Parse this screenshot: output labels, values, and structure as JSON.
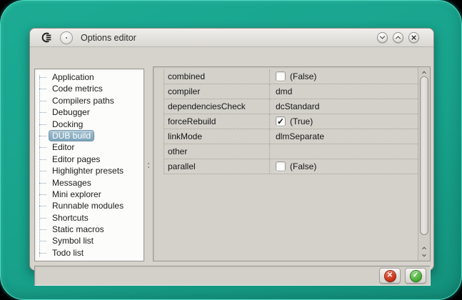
{
  "colors": {
    "teal_background": "#18a28c",
    "teal_rim": "#49e2cb",
    "window_background": "#d6d3cd",
    "selection_blue": "#87acc1",
    "cancel_red": "#c3301a",
    "ok_green": "#4aab38"
  },
  "titlebar": {
    "title": "Options editor",
    "logo_icon": "coedit-logo",
    "menu_button_icon": "window-menu-circle",
    "buttons": [
      {
        "name": "shade",
        "icon": "chevron-down-icon"
      },
      {
        "name": "maximize",
        "icon": "chevron-up-icon"
      },
      {
        "name": "close",
        "icon": "close-x-icon",
        "glyph": "×"
      }
    ]
  },
  "sidebar": {
    "items": [
      {
        "label": "Application",
        "selected": false
      },
      {
        "label": "Code metrics",
        "selected": false
      },
      {
        "label": "Compilers paths",
        "selected": false
      },
      {
        "label": "Debugger",
        "selected": false
      },
      {
        "label": "Docking",
        "selected": false
      },
      {
        "label": "DUB build",
        "selected": true
      },
      {
        "label": "Editor",
        "selected": false
      },
      {
        "label": "Editor pages",
        "selected": false
      },
      {
        "label": "Highlighter presets",
        "selected": false
      },
      {
        "label": "Messages",
        "selected": false
      },
      {
        "label": "Mini explorer",
        "selected": false
      },
      {
        "label": "Runnable modules",
        "selected": false
      },
      {
        "label": "Shortcuts",
        "selected": false
      },
      {
        "label": "Static macros",
        "selected": false
      },
      {
        "label": "Symbol list",
        "selected": false
      },
      {
        "label": "Todo list",
        "selected": false
      }
    ]
  },
  "property_grid": {
    "rows": [
      {
        "name": "combined",
        "type": "bool",
        "checked": false,
        "display": "(False)"
      },
      {
        "name": "compiler",
        "type": "text",
        "display": "dmd"
      },
      {
        "name": "dependenciesCheck",
        "type": "text",
        "display": "dcStandard"
      },
      {
        "name": "forceRebuild",
        "type": "bool",
        "checked": true,
        "display": "(True)"
      },
      {
        "name": "linkMode",
        "type": "text",
        "display": "dlmSeparate"
      },
      {
        "name": "other",
        "type": "text",
        "display": ""
      },
      {
        "name": "parallel",
        "type": "bool",
        "checked": false,
        "display": "(False)"
      }
    ]
  },
  "footer": {
    "buttons": [
      {
        "name": "cancel",
        "icon": "cancel-circle-x-icon",
        "glyph": "✕"
      },
      {
        "name": "accept",
        "icon": "ok-circle-check-icon",
        "glyph": "✓"
      }
    ]
  },
  "icons": {
    "checkbox_check": "✓"
  }
}
